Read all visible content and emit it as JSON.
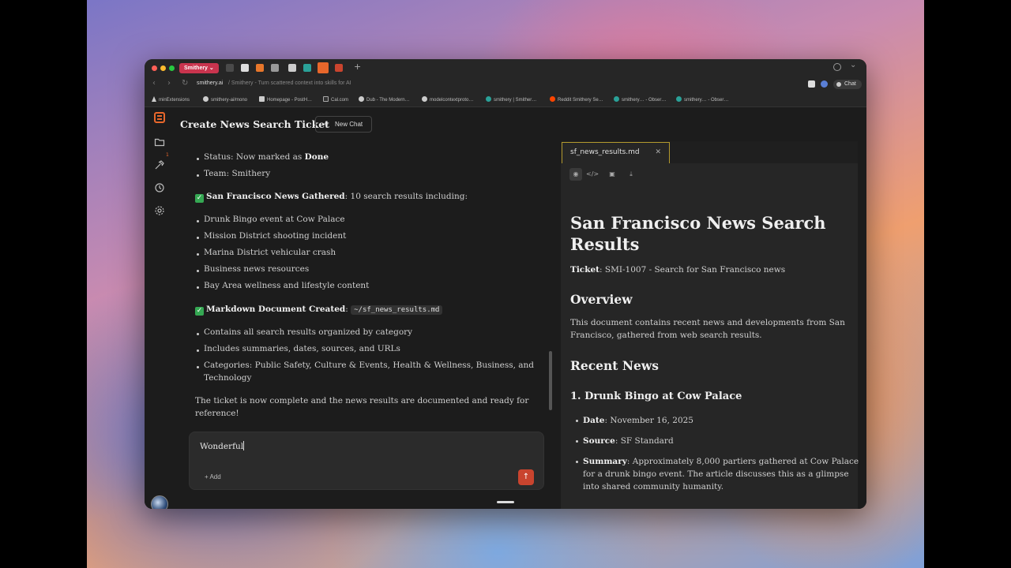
{
  "browser": {
    "profile": "Smithery",
    "url_host": "smithery.ai",
    "url_title": "/ Smithery - Turn scattered context into skills for AI",
    "chat_button": "Chat",
    "bookmarks": [
      "minExtensions",
      "smithery-ai/mono",
      "Homepage - PostH…",
      "Cal.com",
      "Dub - The Modern…",
      "modelcontextproto…",
      "smithery | Smither…",
      "Reddit Smithery Se…",
      "smithery… - Obser…",
      "smithery… - Obser…"
    ]
  },
  "sidebar": {
    "tools_badge": "1"
  },
  "chat": {
    "title": "Create News Search Ticket",
    "new_chat_label": "New Chat",
    "lines": {
      "status_prefix": "Status: Now marked as ",
      "status_value": "Done",
      "team": "Team: Smithery",
      "gathered_bold": "San Francisco News Gathered",
      "gathered_rest": ": 10 search results including:",
      "news_items": [
        "Drunk Bingo event at Cow Palace",
        "Mission District shooting incident",
        "Marina District vehicular crash",
        "Business news resources",
        "Bay Area wellness and lifestyle content"
      ],
      "doc_created_bold": "Markdown Document Created",
      "doc_created_colon": ":",
      "doc_path": "~/sf_news_results.md",
      "doc_items": [
        "Contains all search results organized by category",
        "Includes summaries, dates, sources, and URLs",
        "Categories: Public Safety, Culture & Events, Health & Wellness, Business, and",
        "Technology"
      ],
      "closing_1": "The ticket is now complete and the news results are documented and ready for",
      "closing_2": "reference!"
    },
    "composer_value": "Wonderful",
    "add_label": "Add"
  },
  "document": {
    "tab_name": "sf_news_results.md",
    "h1_line1": "San Francisco News Search",
    "h1_line2": "Results",
    "ticket_label": "Ticket",
    "ticket_value": ": SMI-1007 - Search for San Francisco news",
    "overview_heading": "Overview",
    "overview_line1": "This document contains recent news and developments from San",
    "overview_line2": "Francisco, gathered from web search results.",
    "recent_heading": "Recent News",
    "item1_heading": "1. Drunk Bingo at Cow Palace",
    "date_label": "Date",
    "date_value": ": November 16, 2025",
    "source_label": "Source",
    "source_value": ": SF Standard",
    "summary_label": "Summary",
    "summary_line1": ": Approximately 8,000 partiers gathered at Cow Palace",
    "summary_line2": "for a drunk bingo event. The article discusses this as a glimpse",
    "summary_line3": "into shared community humanity."
  },
  "colors": {
    "accent": "#e8672b",
    "profile_chip": "#c9344e",
    "check": "#35a853",
    "send": "#c9442e",
    "active_tab_border": "#b39a2e"
  },
  "icons": {
    "rail": [
      "smithery-logo-icon",
      "folder-icon",
      "tools-icon",
      "history-icon",
      "settings-icon"
    ],
    "doc_toolbar": [
      "eye-icon",
      "code-icon",
      "save-icon",
      "download-icon"
    ]
  }
}
